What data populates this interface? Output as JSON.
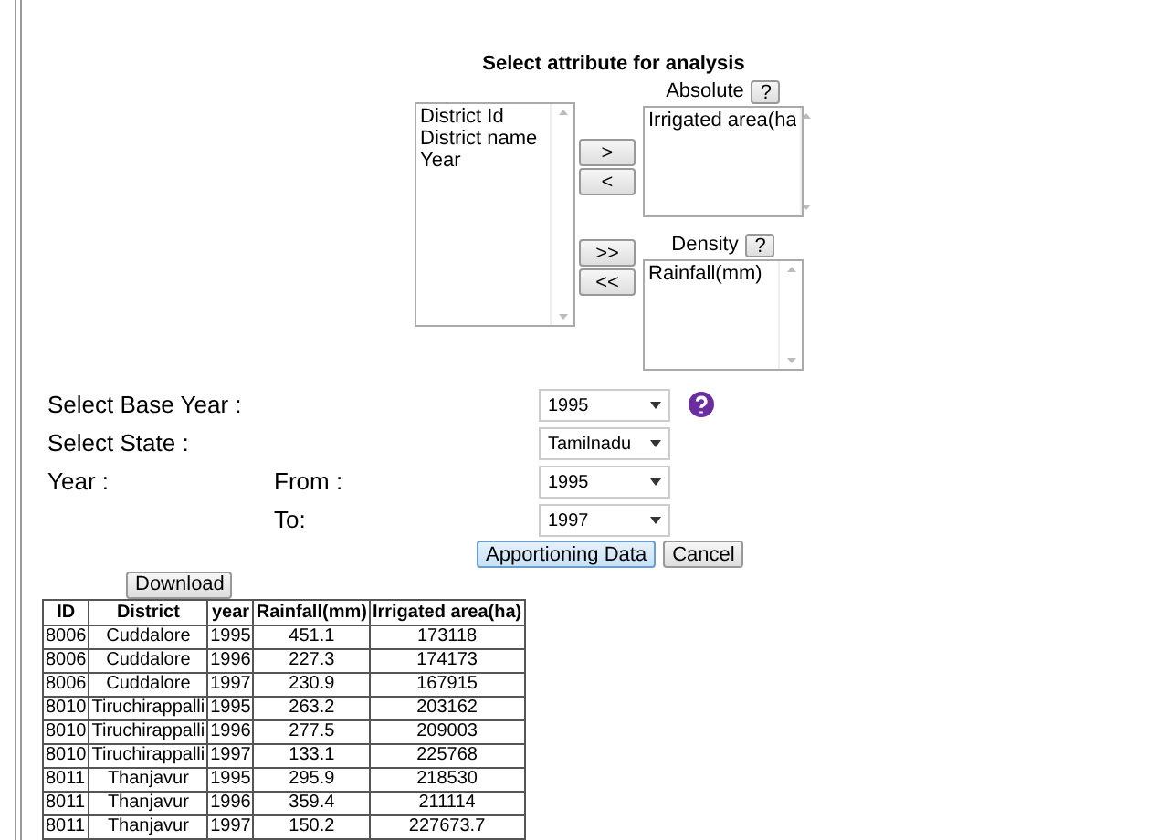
{
  "title": "Select attribute for analysis",
  "available_attributes": [
    "District Id",
    "District name",
    "Year"
  ],
  "move_buttons": [
    ">",
    "<"
  ],
  "move_all_buttons": [
    ">>",
    "<<"
  ],
  "absolute": {
    "label": "Absolute",
    "help": "?",
    "items": [
      "Irrigated area(ha"
    ]
  },
  "density": {
    "label": "Density",
    "help": "?",
    "items": [
      "Rainfall(mm)"
    ]
  },
  "form": [
    {
      "kind": "single",
      "label": "Select Base Year :",
      "value": "1995",
      "help_icon": true
    },
    {
      "kind": "single",
      "label": "Select State :",
      "value": "Tamilnadu",
      "help_icon": false
    },
    {
      "kind": "pair",
      "label": "Year :",
      "sublabel": "From :",
      "value": "1995",
      "help_icon": false
    },
    {
      "kind": "pair",
      "sublabel": "To:",
      "value": "1997",
      "help_icon": false
    }
  ],
  "actions": [
    {
      "label": "Apportioning Data",
      "primary": true
    },
    {
      "label": "Cancel",
      "primary": false
    }
  ],
  "download": "Download",
  "table": {
    "columns": [
      "ID",
      "District",
      "year",
      "Rainfall(mm)",
      "Irrigated area(ha)"
    ],
    "rows": [
      [
        "8006",
        "Cuddalore",
        "1995",
        "451.1",
        "173118"
      ],
      [
        "8006",
        "Cuddalore",
        "1996",
        "227.3",
        "174173"
      ],
      [
        "8006",
        "Cuddalore",
        "1997",
        "230.9",
        "167915"
      ],
      [
        "8010",
        "Tiruchirappalli",
        "1995",
        "263.2",
        "203162"
      ],
      [
        "8010",
        "Tiruchirappalli",
        "1996",
        "277.5",
        "209003"
      ],
      [
        "8010",
        "Tiruchirappalli",
        "1997",
        "133.1",
        "225768"
      ],
      [
        "8011",
        "Thanjavur",
        "1995",
        "295.9",
        "218530"
      ],
      [
        "8011",
        "Thanjavur",
        "1996",
        "359.4",
        "211114"
      ],
      [
        "8011",
        "Thanjavur",
        "1997",
        "150.2",
        "227673.7"
      ]
    ]
  }
}
